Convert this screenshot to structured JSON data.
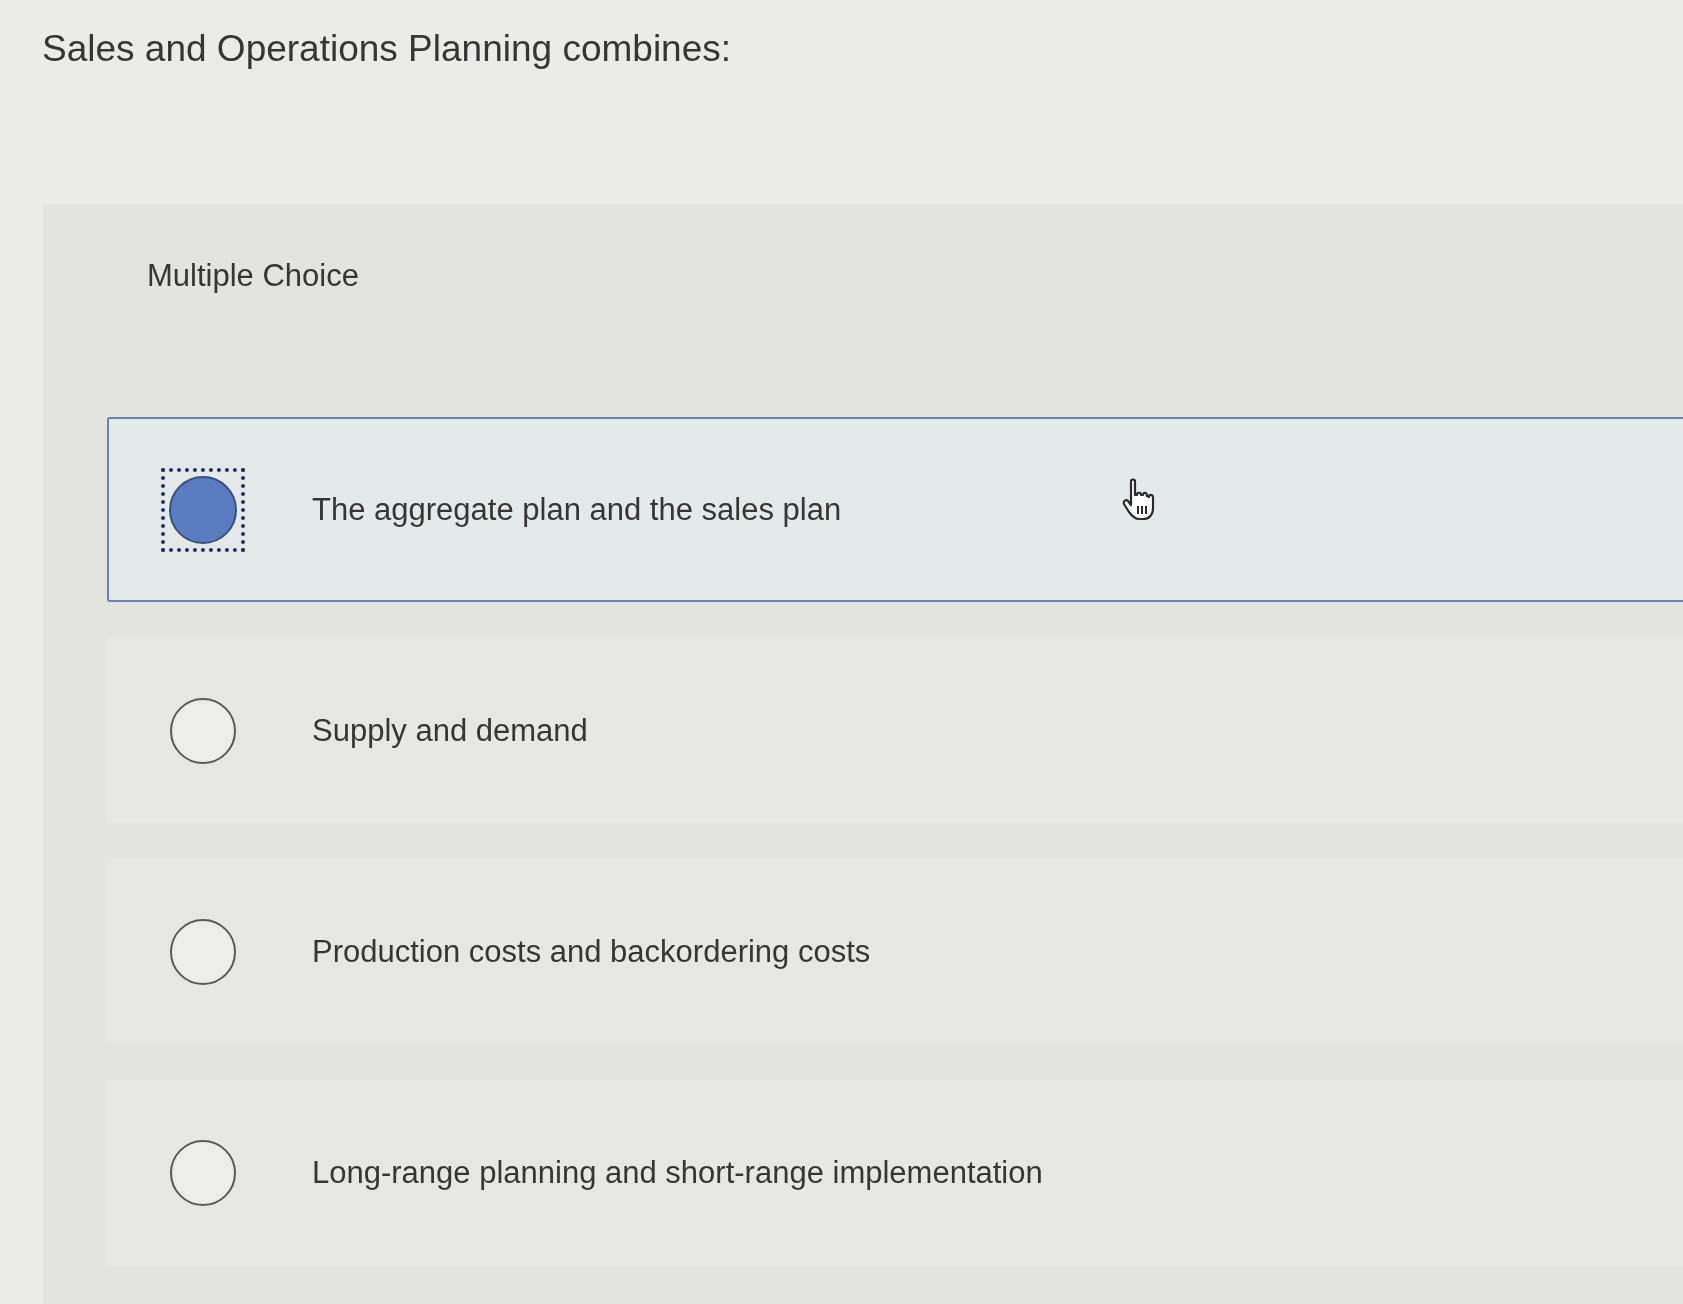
{
  "question": {
    "text": "Sales and Operations Planning combines:"
  },
  "panel": {
    "label": "Multiple Choice"
  },
  "options": [
    {
      "label": "The aggregate plan and the sales plan",
      "selected": true
    },
    {
      "label": "Supply and demand",
      "selected": false
    },
    {
      "label": "Production costs and backordering costs",
      "selected": false
    },
    {
      "label": "Long-range planning and short-range implementation",
      "selected": false
    }
  ]
}
